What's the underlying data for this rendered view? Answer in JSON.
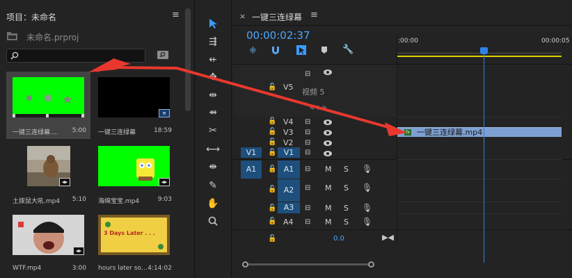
{
  "project": {
    "title": "项目：未命名",
    "menu": "≡",
    "file": "未命名.prproj",
    "search_placeholder": "",
    "clips": [
      {
        "name": "一键三连绿幕.…",
        "duration": "5:00"
      },
      {
        "name": "一键三连绿幕",
        "duration": "18:59"
      },
      {
        "name": "土拨鼠大吼.mp4",
        "duration": "5:10"
      },
      {
        "name": "海绵宝宝.mp4",
        "duration": "9:03"
      },
      {
        "name": "WTF.mp4",
        "duration": "3:00"
      },
      {
        "name": "hours later so…",
        "duration": "4:14:02"
      }
    ],
    "thumb_text": "3 Days Later . . ."
  },
  "timeline": {
    "close": "×",
    "title": "一键三连绿幕",
    "menu": "≡",
    "timecode": "00:00:02:37",
    "ruler": [
      ":00:00",
      "00:00:05"
    ],
    "tracks": {
      "v5": "V5",
      "v5_name": "视频 5",
      "v4": "V4",
      "v3": "V3",
      "v2": "V2",
      "v1_src": "V1",
      "v1": "V1",
      "a1_src": "A1",
      "a1": "A1",
      "a2": "A2",
      "a3": "A3",
      "a4": "A4",
      "m": "M",
      "s": "S",
      "master_value": "0.0"
    },
    "clip_label": "一键三连绿幕.mp4"
  },
  "colors": {
    "accent": "#3d9bff",
    "green_screen": "#00ff00",
    "arrow": "#e8382d",
    "clip": "#7e9fd1",
    "timeline_bar": "#e0d300"
  }
}
